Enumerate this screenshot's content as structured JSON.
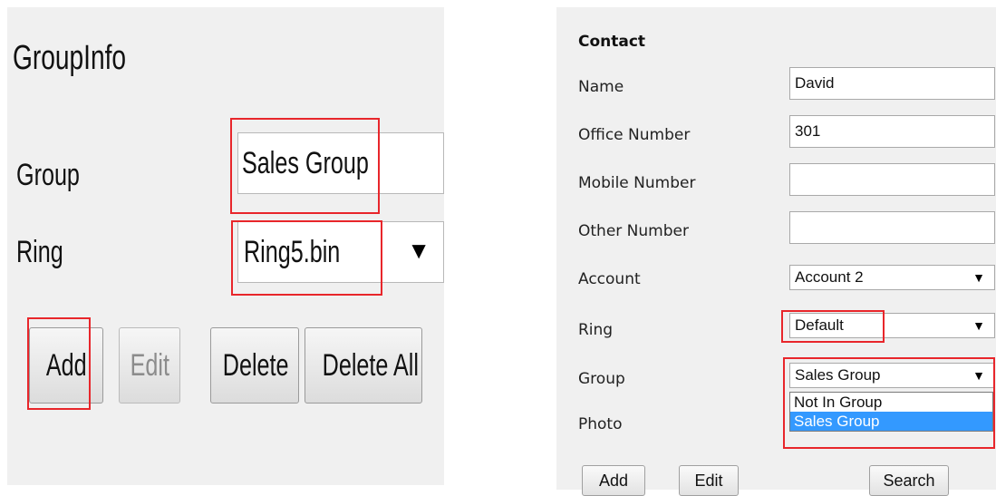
{
  "groupinfo": {
    "title": "GroupInfo",
    "group_label": "Group",
    "group_value": "Sales Group",
    "ring_label": "Ring",
    "ring_value": "Ring5.bin",
    "buttons": {
      "add": "Add",
      "edit": "Edit",
      "delete": "Delete",
      "delete_all": "Delete All"
    }
  },
  "contact": {
    "title": "Contact",
    "fields": {
      "name": {
        "label": "Name",
        "value": "David"
      },
      "office": {
        "label": "Office Number",
        "value": "301"
      },
      "mobile": {
        "label": "Mobile Number",
        "value": ""
      },
      "other": {
        "label": "Other Number",
        "value": ""
      },
      "account": {
        "label": "Account",
        "value": "Account 2"
      },
      "ring": {
        "label": "Ring",
        "value": "Default"
      },
      "group": {
        "label": "Group",
        "value": "Sales Group",
        "options": [
          "Not In Group",
          "Sales Group"
        ]
      },
      "photo": {
        "label": "Photo"
      }
    },
    "buttons": {
      "add": "Add",
      "edit": "Edit",
      "search": "Search"
    }
  },
  "colors": {
    "highlight": "#e8262b",
    "selected_option": "#3399ff",
    "panel_bg": "#f0f0f0"
  },
  "icons": {
    "dropdown": "caret-down-icon"
  }
}
